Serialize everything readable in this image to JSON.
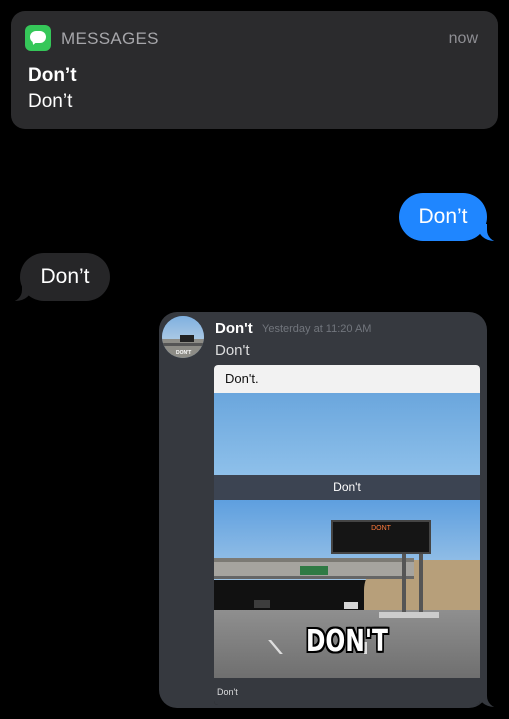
{
  "notification": {
    "app_name": "MESSAGES",
    "time": "now",
    "title": "Don’t",
    "body": "Don’t",
    "app_icon": "messages-icon",
    "accent": "#35c759"
  },
  "conversation": {
    "outgoing_1": "Don’t",
    "incoming_1": "Don’t",
    "outgoing_color": "#1f86ff",
    "incoming_color": "#262628"
  },
  "embedded_screenshot": {
    "username": "Don't",
    "timestamp": "Yesterday at 11:20 AM",
    "message": "Don't",
    "meme": {
      "header_text": "Don't.",
      "caption_bar": "Don't",
      "billboard_text": "DONT",
      "big_caption": "DON'T",
      "footer_text": "Don't"
    }
  }
}
